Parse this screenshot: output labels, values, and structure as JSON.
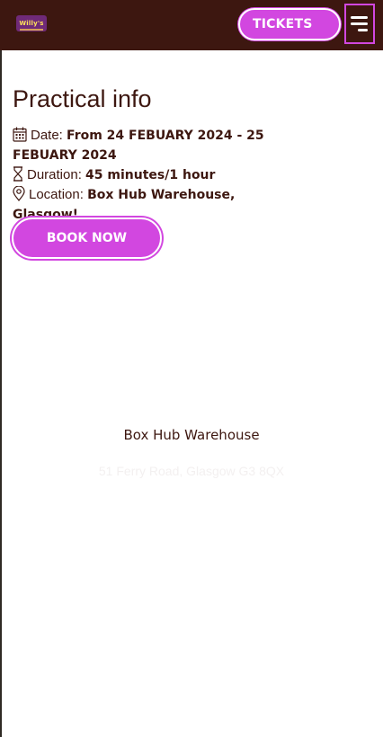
{
  "header": {
    "logo_text": "Willy's",
    "tickets_label": "TICKETS",
    "menu_icon": "hamburger-icon"
  },
  "practical_info": {
    "title": "Practical info",
    "date": {
      "label": "Date:",
      "value": "From 24 FEBUARY 2024 - 25 FEBUARY 2024",
      "icon": "calendar-icon"
    },
    "duration": {
      "label": "Duration:",
      "value": "45 minutes/1 hour",
      "icon": "hourglass-icon"
    },
    "location": {
      "label": "Location:",
      "value": "Box Hub Warehouse, Glasgow!",
      "icon": "location-pin-icon"
    },
    "book_label": "BOOK NOW"
  },
  "venue": {
    "name": "Box Hub Warehouse",
    "address": "51 Ferry Road, Glasgow G3 8QX"
  },
  "colors": {
    "header_bg": "#3d1710",
    "accent": "#d247e0",
    "text": "#3d1710"
  }
}
